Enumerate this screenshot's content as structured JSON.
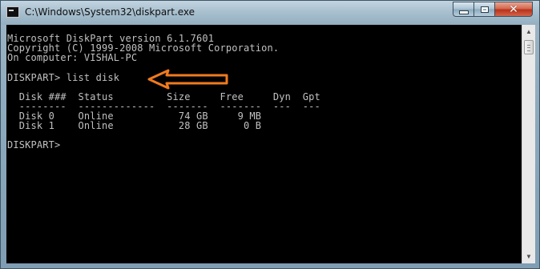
{
  "window": {
    "title": "C:\\Windows\\System32\\diskpart.exe",
    "controls": {
      "minimize": "minimize",
      "maximize": "maximize",
      "close_glyph": "✕"
    }
  },
  "console": {
    "lines": [
      "Microsoft DiskPart version 6.1.7601",
      "Copyright (C) 1999-2008 Microsoft Corporation.",
      "On computer: VISHAL-PC",
      "",
      "DISKPART> list disk",
      "",
      "  Disk ###  Status         Size     Free     Dyn  Gpt",
      "  --------  -------------  -------  -------  ---  ---",
      "  Disk 0    Online           74 GB     9 MB",
      "  Disk 1    Online           28 GB      0 B",
      "",
      "DISKPART> "
    ],
    "text_color": "#c0c0c0",
    "background": "#000000"
  },
  "annotation": {
    "icon": "orange-arrow-icon",
    "color": "#f07a1e"
  },
  "scrollbar": {
    "up_icon": "scroll-up-arrow-icon",
    "down_icon": "scroll-down-arrow-icon"
  }
}
